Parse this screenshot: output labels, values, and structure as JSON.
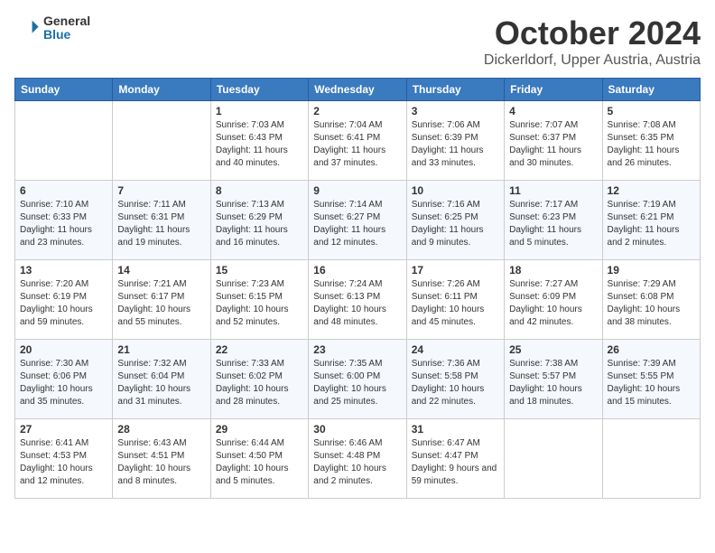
{
  "header": {
    "logo_general": "General",
    "logo_blue": "Blue",
    "month_title": "October 2024",
    "subtitle": "Dickerldorf, Upper Austria, Austria"
  },
  "days_of_week": [
    "Sunday",
    "Monday",
    "Tuesday",
    "Wednesday",
    "Thursday",
    "Friday",
    "Saturday"
  ],
  "weeks": [
    [
      {
        "day": "",
        "info": ""
      },
      {
        "day": "",
        "info": ""
      },
      {
        "day": "1",
        "info": "Sunrise: 7:03 AM\nSunset: 6:43 PM\nDaylight: 11 hours and 40 minutes."
      },
      {
        "day": "2",
        "info": "Sunrise: 7:04 AM\nSunset: 6:41 PM\nDaylight: 11 hours and 37 minutes."
      },
      {
        "day": "3",
        "info": "Sunrise: 7:06 AM\nSunset: 6:39 PM\nDaylight: 11 hours and 33 minutes."
      },
      {
        "day": "4",
        "info": "Sunrise: 7:07 AM\nSunset: 6:37 PM\nDaylight: 11 hours and 30 minutes."
      },
      {
        "day": "5",
        "info": "Sunrise: 7:08 AM\nSunset: 6:35 PM\nDaylight: 11 hours and 26 minutes."
      }
    ],
    [
      {
        "day": "6",
        "info": "Sunrise: 7:10 AM\nSunset: 6:33 PM\nDaylight: 11 hours and 23 minutes."
      },
      {
        "day": "7",
        "info": "Sunrise: 7:11 AM\nSunset: 6:31 PM\nDaylight: 11 hours and 19 minutes."
      },
      {
        "day": "8",
        "info": "Sunrise: 7:13 AM\nSunset: 6:29 PM\nDaylight: 11 hours and 16 minutes."
      },
      {
        "day": "9",
        "info": "Sunrise: 7:14 AM\nSunset: 6:27 PM\nDaylight: 11 hours and 12 minutes."
      },
      {
        "day": "10",
        "info": "Sunrise: 7:16 AM\nSunset: 6:25 PM\nDaylight: 11 hours and 9 minutes."
      },
      {
        "day": "11",
        "info": "Sunrise: 7:17 AM\nSunset: 6:23 PM\nDaylight: 11 hours and 5 minutes."
      },
      {
        "day": "12",
        "info": "Sunrise: 7:19 AM\nSunset: 6:21 PM\nDaylight: 11 hours and 2 minutes."
      }
    ],
    [
      {
        "day": "13",
        "info": "Sunrise: 7:20 AM\nSunset: 6:19 PM\nDaylight: 10 hours and 59 minutes."
      },
      {
        "day": "14",
        "info": "Sunrise: 7:21 AM\nSunset: 6:17 PM\nDaylight: 10 hours and 55 minutes."
      },
      {
        "day": "15",
        "info": "Sunrise: 7:23 AM\nSunset: 6:15 PM\nDaylight: 10 hours and 52 minutes."
      },
      {
        "day": "16",
        "info": "Sunrise: 7:24 AM\nSunset: 6:13 PM\nDaylight: 10 hours and 48 minutes."
      },
      {
        "day": "17",
        "info": "Sunrise: 7:26 AM\nSunset: 6:11 PM\nDaylight: 10 hours and 45 minutes."
      },
      {
        "day": "18",
        "info": "Sunrise: 7:27 AM\nSunset: 6:09 PM\nDaylight: 10 hours and 42 minutes."
      },
      {
        "day": "19",
        "info": "Sunrise: 7:29 AM\nSunset: 6:08 PM\nDaylight: 10 hours and 38 minutes."
      }
    ],
    [
      {
        "day": "20",
        "info": "Sunrise: 7:30 AM\nSunset: 6:06 PM\nDaylight: 10 hours and 35 minutes."
      },
      {
        "day": "21",
        "info": "Sunrise: 7:32 AM\nSunset: 6:04 PM\nDaylight: 10 hours and 31 minutes."
      },
      {
        "day": "22",
        "info": "Sunrise: 7:33 AM\nSunset: 6:02 PM\nDaylight: 10 hours and 28 minutes."
      },
      {
        "day": "23",
        "info": "Sunrise: 7:35 AM\nSunset: 6:00 PM\nDaylight: 10 hours and 25 minutes."
      },
      {
        "day": "24",
        "info": "Sunrise: 7:36 AM\nSunset: 5:58 PM\nDaylight: 10 hours and 22 minutes."
      },
      {
        "day": "25",
        "info": "Sunrise: 7:38 AM\nSunset: 5:57 PM\nDaylight: 10 hours and 18 minutes."
      },
      {
        "day": "26",
        "info": "Sunrise: 7:39 AM\nSunset: 5:55 PM\nDaylight: 10 hours and 15 minutes."
      }
    ],
    [
      {
        "day": "27",
        "info": "Sunrise: 6:41 AM\nSunset: 4:53 PM\nDaylight: 10 hours and 12 minutes."
      },
      {
        "day": "28",
        "info": "Sunrise: 6:43 AM\nSunset: 4:51 PM\nDaylight: 10 hours and 8 minutes."
      },
      {
        "day": "29",
        "info": "Sunrise: 6:44 AM\nSunset: 4:50 PM\nDaylight: 10 hours and 5 minutes."
      },
      {
        "day": "30",
        "info": "Sunrise: 6:46 AM\nSunset: 4:48 PM\nDaylight: 10 hours and 2 minutes."
      },
      {
        "day": "31",
        "info": "Sunrise: 6:47 AM\nSunset: 4:47 PM\nDaylight: 9 hours and 59 minutes."
      },
      {
        "day": "",
        "info": ""
      },
      {
        "day": "",
        "info": ""
      }
    ]
  ]
}
